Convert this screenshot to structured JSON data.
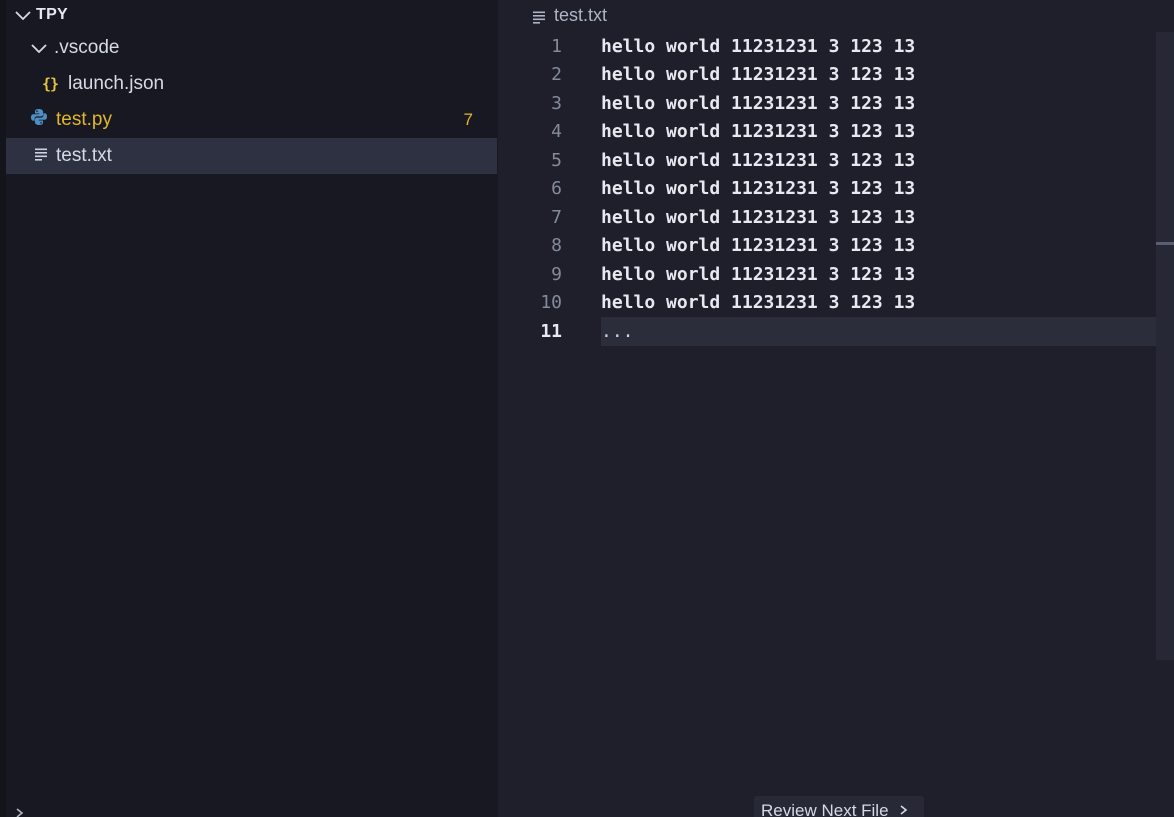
{
  "explorer": {
    "root": "TPY",
    "items": [
      {
        "label": ".vscode",
        "kind": "folder",
        "expanded": true
      },
      {
        "label": "launch.json",
        "kind": "json",
        "icon": "{}"
      },
      {
        "label": "test.py",
        "kind": "python",
        "badge": "7"
      },
      {
        "label": "test.txt",
        "kind": "text",
        "selected": true
      }
    ]
  },
  "editor": {
    "breadcrumb": "test.txt",
    "lines": [
      {
        "no": "1",
        "text": "hello world 11231231 3 123 13"
      },
      {
        "no": "2",
        "text": "hello world 11231231 3 123 13"
      },
      {
        "no": "3",
        "text": "hello world 11231231 3 123 13"
      },
      {
        "no": "4",
        "text": "hello world 11231231 3 123 13"
      },
      {
        "no": "5",
        "text": "hello world 11231231 3 123 13"
      },
      {
        "no": "6",
        "text": "hello world 11231231 3 123 13"
      },
      {
        "no": "7",
        "text": "hello world 11231231 3 123 13"
      },
      {
        "no": "8",
        "text": "hello world 11231231 3 123 13"
      },
      {
        "no": "9",
        "text": "hello world 11231231 3 123 13"
      },
      {
        "no": "10",
        "text": "hello world 11231231 3 123 13"
      },
      {
        "no": "11",
        "text": "..."
      }
    ],
    "current_line": "11"
  },
  "review": {
    "label": "Review Next File",
    "icon": "chevron-right-icon"
  },
  "colors": {
    "sidebar_bg": "#171822",
    "editor_bg": "#1e1f2b",
    "selection_bg": "#2e3142",
    "python_accent": "#e2b72a",
    "json_accent": "#e2c53a"
  }
}
